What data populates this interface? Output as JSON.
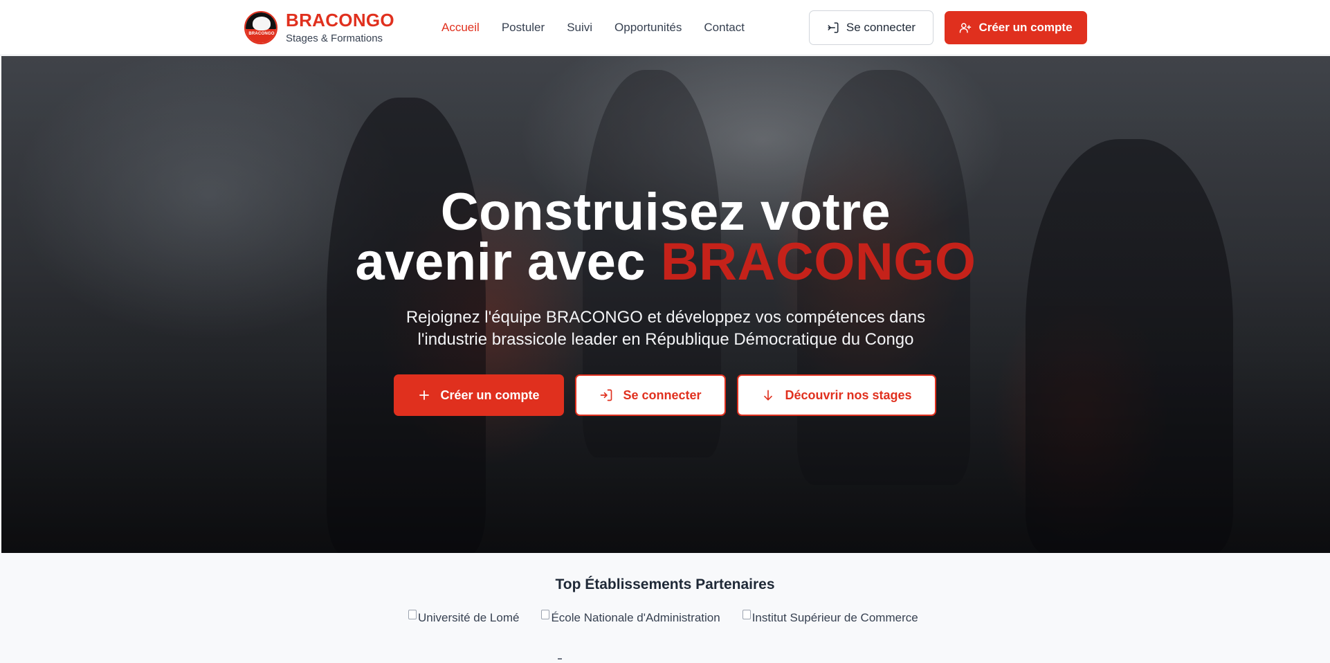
{
  "header": {
    "brand_name": "BRACONGO",
    "brand_sub": "Stages & Formations",
    "logo_text": "BRACONGO",
    "nav": [
      {
        "label": "Accueil",
        "active": true
      },
      {
        "label": "Postuler",
        "active": false
      },
      {
        "label": "Suivi",
        "active": false
      },
      {
        "label": "Opportunités",
        "active": false
      },
      {
        "label": "Contact",
        "active": false
      }
    ],
    "login_label": "Se connecter",
    "signup_label": "Créer un compte"
  },
  "hero": {
    "title_line1": "Construisez votre",
    "title_line2_prefix": "avenir avec ",
    "title_accent": "BRACONGO",
    "subtitle_line1": "Rejoignez l'équipe BRACONGO et développez vos compétences dans",
    "subtitle_line2": "l'industrie brassicole leader en République Démocratique du Congo",
    "btn_signup": "Créer un compte",
    "btn_login": "Se connecter",
    "btn_discover": "Découvrir nos stages"
  },
  "partners": {
    "title": "Top Établissements Partenaires",
    "items": [
      "Université de Lomé",
      "École Nationale d'Administration",
      "Institut Supérieur de Commerce"
    ]
  },
  "colors": {
    "brand": "#e0301e",
    "accent_dark": "#c5221a",
    "text": "#1f2937"
  },
  "icons": {
    "login": "login-icon",
    "signup": "user-plus-icon",
    "plus": "plus-icon",
    "arrow_down": "arrow-down-icon"
  }
}
